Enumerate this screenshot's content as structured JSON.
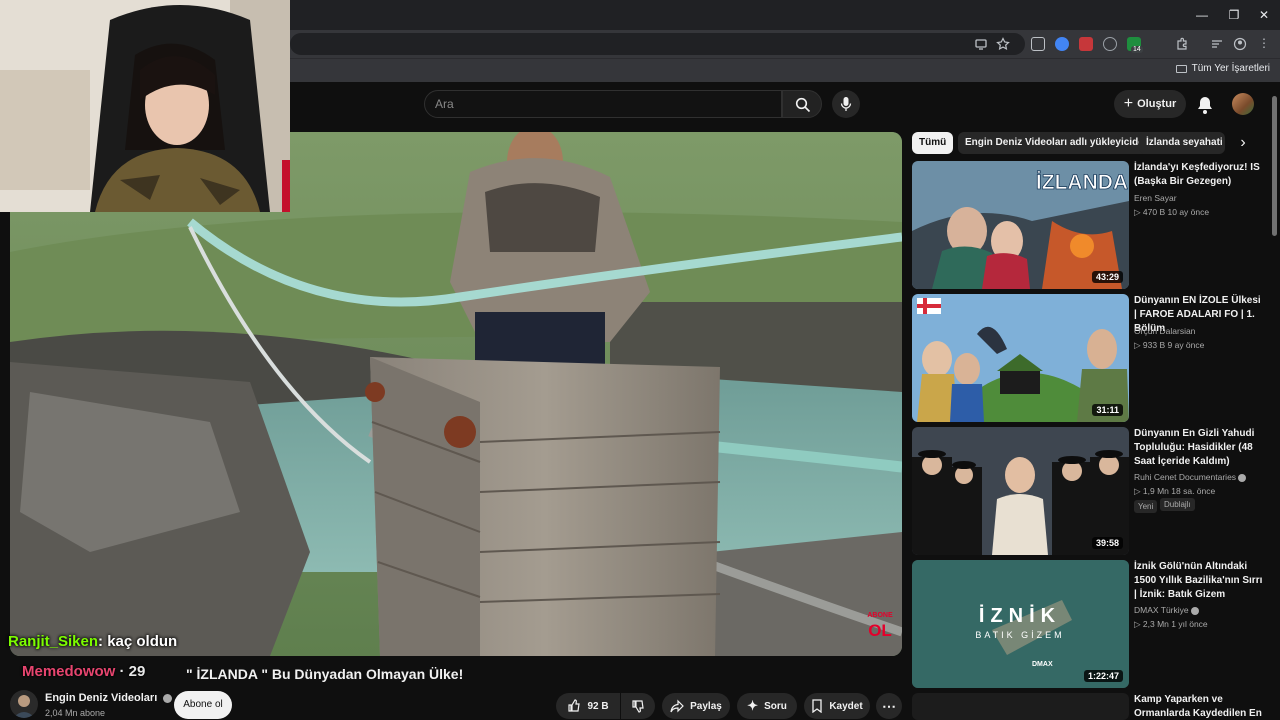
{
  "browser": {
    "window_controls": {
      "minimize": "—",
      "maximize": "❐",
      "close": "✕"
    },
    "extension_badge": "14",
    "bookmarks_folder": "Tüm Yer İşaretleri"
  },
  "youtube": {
    "search_placeholder": "Ara",
    "create_label": "Oluştur"
  },
  "stream_overlay": {
    "chat": [
      {
        "user": "Ranjit_Siken",
        "user_color": "#7CFC00",
        "message": ": kaç oldun"
      },
      {
        "user": "Memedowow",
        "user_color": "#ff4b7a",
        "message": "· 29"
      }
    ],
    "video_watermark": "ABONE OL"
  },
  "video": {
    "title": "\" İZLANDA \" Bu Dünyadan Olmayan Ülke!",
    "channel": "Engin Deniz Videoları",
    "subscribers": "2,04 Mn abone",
    "subscribe_label": "Abone ol",
    "likes": "92 B",
    "share_label": "Paylaş",
    "ask_label": "Soru",
    "save_label": "Kaydet"
  },
  "sidebar": {
    "chips": [
      "Tümü",
      "Engin Deniz Videoları adlı yükleyiciden",
      "İzlanda seyahati"
    ],
    "recommendations": [
      {
        "title": "İzlanda'yı Keşfediyoruz! IS (Başka Bir Gezegen)",
        "channel": "Eren Sayar",
        "views": "470 B",
        "age": "10 ay önce",
        "duration": "43:29",
        "thumb_text": "İZLANDA",
        "verified": false
      },
      {
        "title": "Dünyanın EN İZOLE Ülkesi | FAROE ADALARI FO | 1. Bölüm",
        "channel": "Orçun Dalarsian",
        "views": "933 B",
        "age": "9 ay önce",
        "duration": "31:11",
        "verified": false
      },
      {
        "title": "Dünyanın En Gizli Yahudi Topluluğu: Hasidikler (48 Saat İçeride Kaldım)",
        "channel": "Ruhi Cenet Documentaries",
        "views": "1,9 Mn",
        "age": "18 sa. önce",
        "duration": "39:58",
        "badges": [
          "Yeni",
          "Dublajlı"
        ],
        "verified": true
      },
      {
        "title": "İznik Gölü'nün Altındaki 1500 Yıllık Bazilika'nın Sırrı | İznik: Batık Gizem",
        "channel": "DMAX Türkiye",
        "views": "2,3 Mn",
        "age": "1 yıl önce",
        "duration": "1:22:47",
        "thumb_text": "İZNİK",
        "thumb_subtext": "BATIK GİZEM",
        "thumb_logo": "DMAX",
        "verified": true
      },
      {
        "title": "Kamp Yaparken ve Ormanlarda Kaydedilen En",
        "channel": "",
        "views": "",
        "age": "",
        "duration": "",
        "verified": false
      }
    ]
  },
  "colors": {
    "background": "#0f0f0f",
    "chrome": "#202124",
    "accent_red": "#e4002b"
  }
}
